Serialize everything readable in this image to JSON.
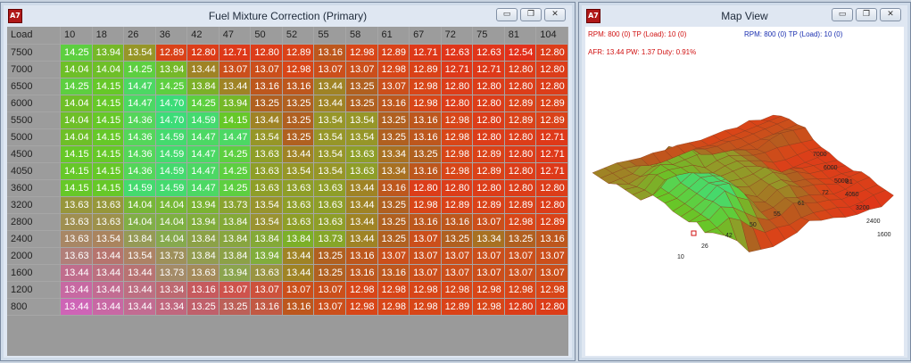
{
  "left_window": {
    "title": "Fuel Mixture Correction (Primary)",
    "icon_text": "A7",
    "corner_label": "Load",
    "columns": [
      "10",
      "18",
      "26",
      "36",
      "42",
      "47",
      "50",
      "52",
      "55",
      "58",
      "61",
      "67",
      "72",
      "75",
      "81",
      "104"
    ],
    "rows": [
      {
        "rpm": "7500",
        "values": [
          "14.25",
          "13.94",
          "13.54",
          "12.89",
          "12.80",
          "12.71",
          "12.80",
          "12.89",
          "13.16",
          "12.98",
          "12.89",
          "12.71",
          "12.63",
          "12.63",
          "12.54",
          "12.80"
        ]
      },
      {
        "rpm": "7000",
        "values": [
          "14.04",
          "14.04",
          "14.25",
          "13.94",
          "13.44",
          "13.07",
          "13.07",
          "12.98",
          "13.07",
          "13.07",
          "12.98",
          "12.89",
          "12.71",
          "12.71",
          "12.80",
          "12.80"
        ]
      },
      {
        "rpm": "6500",
        "values": [
          "14.25",
          "14.15",
          "14.47",
          "14.25",
          "13.84",
          "13.44",
          "13.16",
          "13.16",
          "13.44",
          "13.25",
          "13.07",
          "12.98",
          "12.80",
          "12.80",
          "12.80",
          "12.80"
        ]
      },
      {
        "rpm": "6000",
        "values": [
          "14.04",
          "14.15",
          "14.47",
          "14.70",
          "14.25",
          "13.94",
          "13.25",
          "13.25",
          "13.44",
          "13.25",
          "13.16",
          "12.98",
          "12.80",
          "12.80",
          "12.89",
          "12.89"
        ]
      },
      {
        "rpm": "5500",
        "values": [
          "14.04",
          "14.15",
          "14.36",
          "14.70",
          "14.59",
          "14.15",
          "13.44",
          "13.25",
          "13.54",
          "13.54",
          "13.25",
          "13.16",
          "12.98",
          "12.80",
          "12.89",
          "12.89"
        ]
      },
      {
        "rpm": "5000",
        "values": [
          "14.04",
          "14.15",
          "14.36",
          "14.59",
          "14.47",
          "14.47",
          "13.54",
          "13.25",
          "13.54",
          "13.54",
          "13.25",
          "13.16",
          "12.98",
          "12.80",
          "12.80",
          "12.71"
        ]
      },
      {
        "rpm": "4500",
        "values": [
          "14.15",
          "14.15",
          "14.36",
          "14.59",
          "14.47",
          "14.25",
          "13.63",
          "13.44",
          "13.54",
          "13.63",
          "13.34",
          "13.25",
          "12.98",
          "12.89",
          "12.80",
          "12.71"
        ]
      },
      {
        "rpm": "4050",
        "values": [
          "14.15",
          "14.15",
          "14.36",
          "14.59",
          "14.47",
          "14.25",
          "13.63",
          "13.54",
          "13.54",
          "13.63",
          "13.34",
          "13.16",
          "12.98",
          "12.89",
          "12.80",
          "12.71"
        ]
      },
      {
        "rpm": "3600",
        "values": [
          "14.15",
          "14.15",
          "14.59",
          "14.59",
          "14.47",
          "14.25",
          "13.63",
          "13.63",
          "13.63",
          "13.44",
          "13.16",
          "12.80",
          "12.80",
          "12.80",
          "12.80",
          "12.80"
        ]
      },
      {
        "rpm": "3200",
        "values": [
          "13.63",
          "13.63",
          "14.04",
          "14.04",
          "13.94",
          "13.73",
          "13.54",
          "13.63",
          "13.63",
          "13.44",
          "13.25",
          "12.98",
          "12.89",
          "12.89",
          "12.89",
          "12.80"
        ]
      },
      {
        "rpm": "2800",
        "values": [
          "13.63",
          "13.63",
          "14.04",
          "14.04",
          "13.94",
          "13.84",
          "13.54",
          "13.63",
          "13.63",
          "13.44",
          "13.25",
          "13.16",
          "13.16",
          "13.07",
          "12.98",
          "12.89"
        ]
      },
      {
        "rpm": "2400",
        "values": [
          "13.63",
          "13.54",
          "13.84",
          "14.04",
          "13.84",
          "13.84",
          "13.84",
          "13.84",
          "13.73",
          "13.44",
          "13.25",
          "13.07",
          "13.25",
          "13.34",
          "13.25",
          "13.16"
        ]
      },
      {
        "rpm": "2000",
        "values": [
          "13.63",
          "13.44",
          "13.54",
          "13.73",
          "13.84",
          "13.84",
          "13.94",
          "13.44",
          "13.25",
          "13.16",
          "13.07",
          "13.07",
          "13.07",
          "13.07",
          "13.07",
          "13.07"
        ]
      },
      {
        "rpm": "1600",
        "values": [
          "13.44",
          "13.44",
          "13.44",
          "13.73",
          "13.63",
          "13.94",
          "13.63",
          "13.44",
          "13.25",
          "13.16",
          "13.16",
          "13.07",
          "13.07",
          "13.07",
          "13.07",
          "13.07"
        ]
      },
      {
        "rpm": "1200",
        "values": [
          "13.44",
          "13.44",
          "13.44",
          "13.34",
          "13.16",
          "13.07",
          "13.07",
          "13.07",
          "13.07",
          "12.98",
          "12.98",
          "12.98",
          "12.98",
          "12.98",
          "12.98",
          "12.98"
        ]
      },
      {
        "rpm": "800",
        "values": [
          "13.44",
          "13.44",
          "13.44",
          "13.34",
          "13.25",
          "13.25",
          "13.16",
          "13.16",
          "13.07",
          "12.98",
          "12.98",
          "12.98",
          "12.89",
          "12.98",
          "12.80",
          "12.80"
        ]
      }
    ]
  },
  "right_window": {
    "title": "Map View",
    "icon_text": "A7",
    "status_line1_left": "RPM: 800 (0)   TP (Load): 10 (0)",
    "status_line1_right": "RPM: 800 (0)   TP (Load): 10 (0)",
    "status_line2": "AFR: 13.44   PW: 1.37   Duty: 0.91%",
    "load_axis_labels": [
      "10",
      "26",
      "42",
      "50",
      "55",
      "61",
      "72",
      "81"
    ],
    "rpm_axis_labels": [
      "7000",
      "6000",
      "5000",
      "4050",
      "3200",
      "2400",
      "1600"
    ]
  },
  "window_buttons": {
    "minimize": "▭",
    "restore": "❐",
    "close": "✕"
  },
  "colors": {
    "green": "#4fd84f",
    "red": "#e8321e",
    "pink": "#d65fd0",
    "header_gray": "#9c9c9c"
  }
}
